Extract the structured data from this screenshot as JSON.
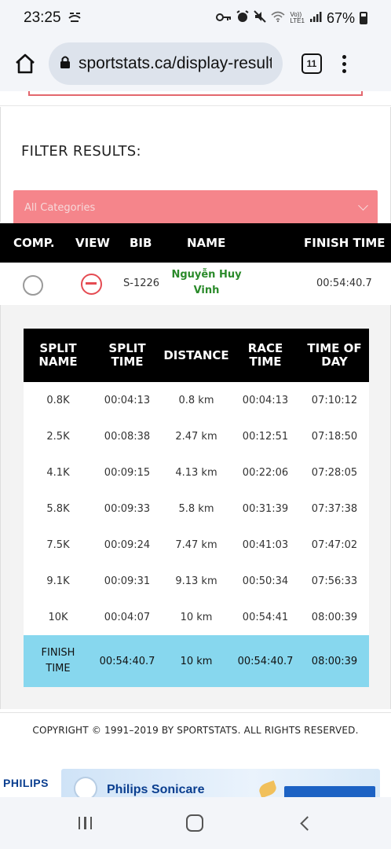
{
  "status_bar": {
    "time": "23:25",
    "battery": "67%",
    "icons": [
      "sleep-icon",
      "key-icon",
      "alarm-icon",
      "mute-icon",
      "wifi-icon",
      "volte-icon",
      "signal-icon",
      "battery-icon"
    ],
    "volte_text": "Vo))\nLTE1"
  },
  "browser": {
    "url": "sportstats.ca/display-result",
    "tab_count": "11"
  },
  "filter": {
    "title": "FILTER RESULTS:",
    "selected": "All Categories"
  },
  "results_table": {
    "headers": [
      "COMP.",
      "VIEW",
      "BIB",
      "NAME",
      "FINISH TIME"
    ],
    "row": {
      "bib": "S-1226",
      "name_line1": "Nguyễn Huy",
      "name_line2": "Vinh",
      "finish_time": "00:54:40.7"
    }
  },
  "split_table": {
    "headers": [
      "SPLIT\nNAME",
      "SPLIT\nTIME",
      "DISTANCE",
      "RACE\nTIME",
      "TIME OF\nDAY"
    ],
    "rows": [
      [
        "0.8K",
        "00:04:13",
        "0.8 km",
        "00:04:13",
        "07:10:12"
      ],
      [
        "2.5K",
        "00:08:38",
        "2.47 km",
        "00:12:51",
        "07:18:50"
      ],
      [
        "4.1K",
        "00:09:15",
        "4.13 km",
        "00:22:06",
        "07:28:05"
      ],
      [
        "5.8K",
        "00:09:33",
        "5.8 km",
        "00:31:39",
        "07:37:38"
      ],
      [
        "7.5K",
        "00:09:24",
        "7.47 km",
        "00:41:03",
        "07:47:02"
      ],
      [
        "9.1K",
        "00:09:31",
        "9.13 km",
        "00:50:34",
        "07:56:33"
      ],
      [
        "10K",
        "00:04:07",
        "10 km",
        "00:54:41",
        "08:00:39"
      ]
    ],
    "finish_row": [
      "FINISH\nTIME",
      "00:54:40.7",
      "10 km",
      "00:54:40.7",
      "08:00:39"
    ]
  },
  "footer": {
    "copyright": "COPYRIGHT © 1991–2019 BY SPORTSTATS. ALL RIGHTS RESERVED."
  },
  "ad": {
    "brand": "PHILIPS",
    "product": "Philips Sonicare"
  },
  "colors": {
    "filter_bg": "#f5858b",
    "header_bg": "#000000",
    "finish_row_bg": "#87d7ee",
    "name_green": "#2a8a2a",
    "remove_red": "#e54b52"
  }
}
